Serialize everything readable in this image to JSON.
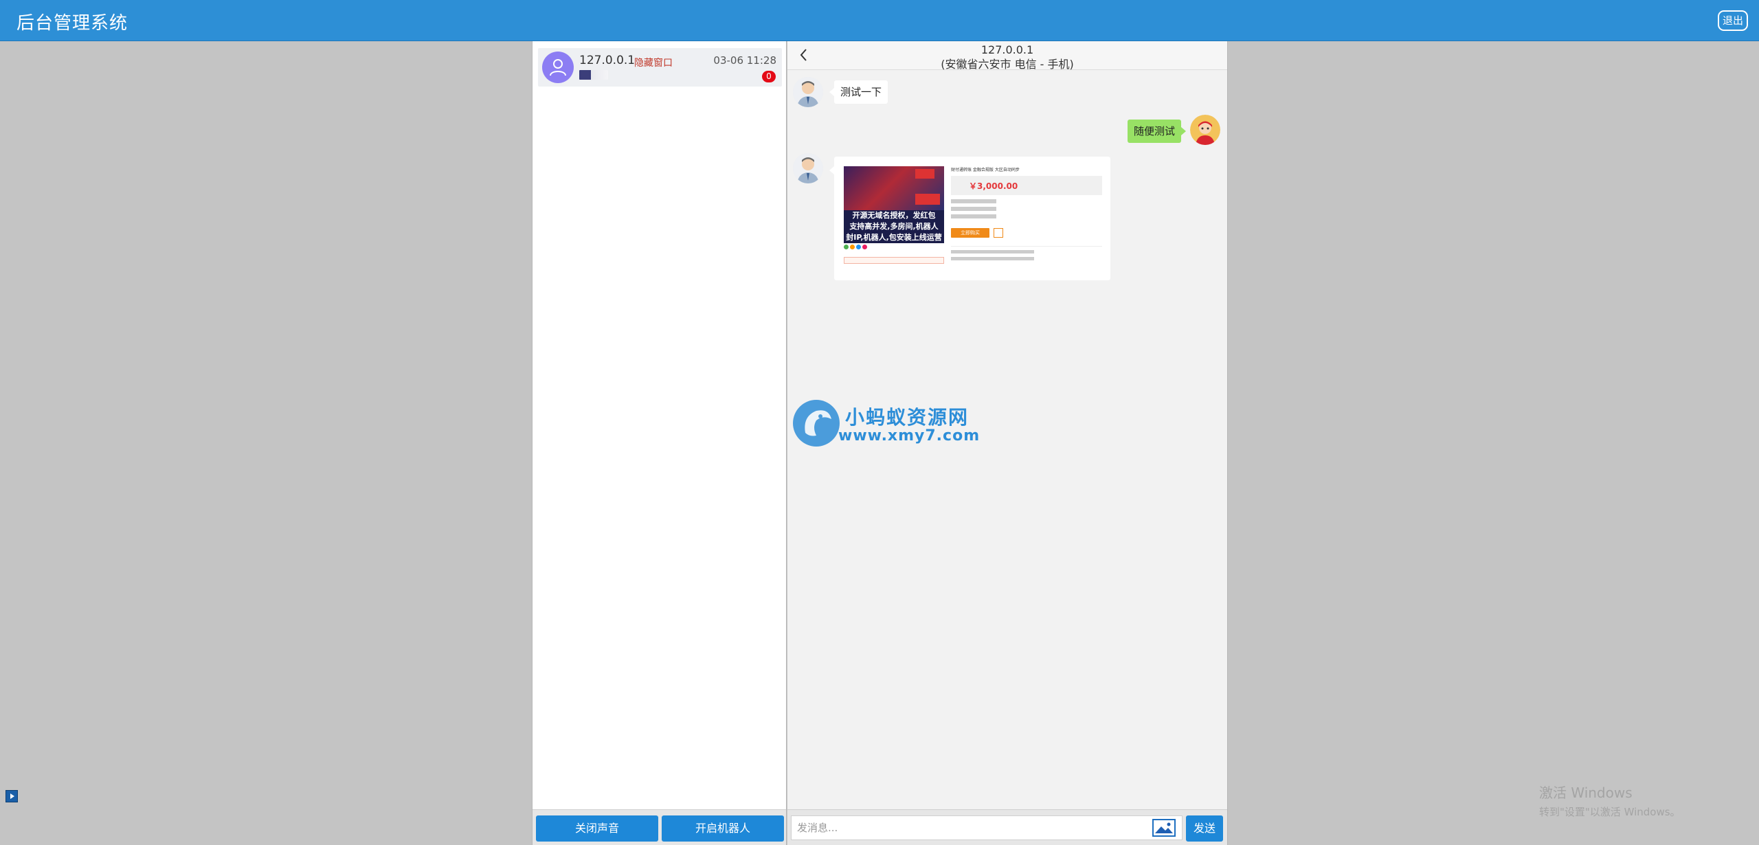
{
  "header": {
    "title": "后台管理系统",
    "logout_label": "退出"
  },
  "conversations": [
    {
      "ip": "127.0.0.1",
      "tag": "隐藏窗口",
      "time": "03-06 11:28",
      "unread": "0"
    }
  ],
  "left_footer": {
    "sound_button": "关闭声音",
    "robot_button": "开启机器人"
  },
  "chat": {
    "ip": "127.0.0.1",
    "location": "(安徽省六安市 电信 - 手机)",
    "messages": [
      {
        "side": "left",
        "text": "测试一下"
      },
      {
        "side": "right",
        "text": "随便测试"
      }
    ],
    "image_message": {
      "caption_line1": "开源无域名授权，发红包",
      "caption_line2": "支持高并发,多房间,机器人",
      "caption_line3": "封IP,机器人,包安装上线运营",
      "product_title": "财付通转账 金融合规版 大区自动同步",
      "price": "￥3,000.00",
      "buy_label": "立即购买"
    },
    "input_placeholder": "发消息...",
    "send_label": "发送"
  },
  "watermark": {
    "line1": "小蚂蚁资源网",
    "line2": "www.xmy7.com"
  },
  "windows_activation": {
    "line1": "激活 Windows",
    "line2": "转到\"设置\"以激活 Windows。"
  },
  "colors": {
    "brand": "#2d8fd6",
    "button": "#1e88d8",
    "bubble_right": "#98e165",
    "badge": "#e40a16"
  }
}
